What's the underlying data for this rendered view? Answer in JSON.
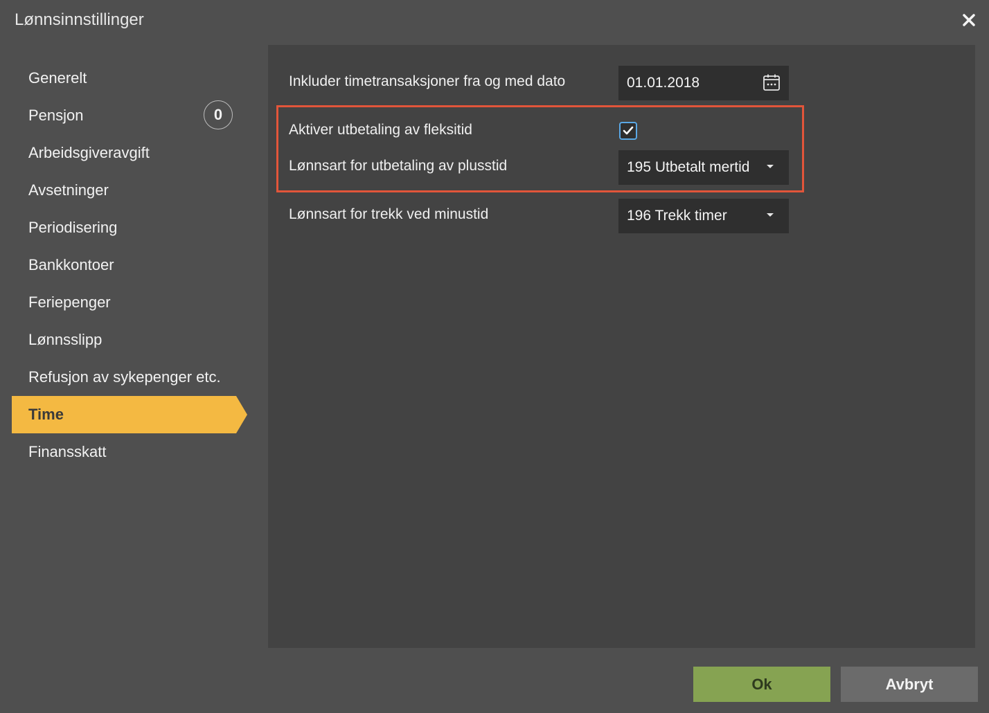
{
  "dialog": {
    "title": "Lønnsinnstillinger"
  },
  "sidebar": {
    "items": [
      {
        "label": "Generelt"
      },
      {
        "label": "Pensjon",
        "badge": "0"
      },
      {
        "label": "Arbeidsgiveravgift"
      },
      {
        "label": "Avsetninger"
      },
      {
        "label": "Periodisering"
      },
      {
        "label": "Bankkontoer"
      },
      {
        "label": "Feriepenger"
      },
      {
        "label": "Lønnsslipp"
      },
      {
        "label": "Refusjon av sykepenger etc."
      },
      {
        "label": "Time",
        "active": true
      },
      {
        "label": "Finansskatt"
      }
    ]
  },
  "settings": {
    "include_from_date": {
      "label": "Inkluder timetransaksjoner fra og med dato",
      "value": "01.01.2018"
    },
    "activate_flex_payout": {
      "label": "Aktiver utbetaling av fleksitid",
      "checked": true
    },
    "wage_type_plus": {
      "label": "Lønnsart for utbetaling av plusstid",
      "value": "195 Utbetalt mertid"
    },
    "wage_type_minus": {
      "label": "Lønnsart for trekk ved minustid",
      "value": "196 Trekk timer"
    }
  },
  "footer": {
    "ok_label": "Ok",
    "cancel_label": "Avbryt"
  },
  "colors": {
    "active_nav": "#f4b942",
    "ok_button": "#86a352",
    "cancel_button": "#6b6b6b",
    "highlight_border": "#e2553a",
    "checkbox_border": "#5aa8e6"
  }
}
